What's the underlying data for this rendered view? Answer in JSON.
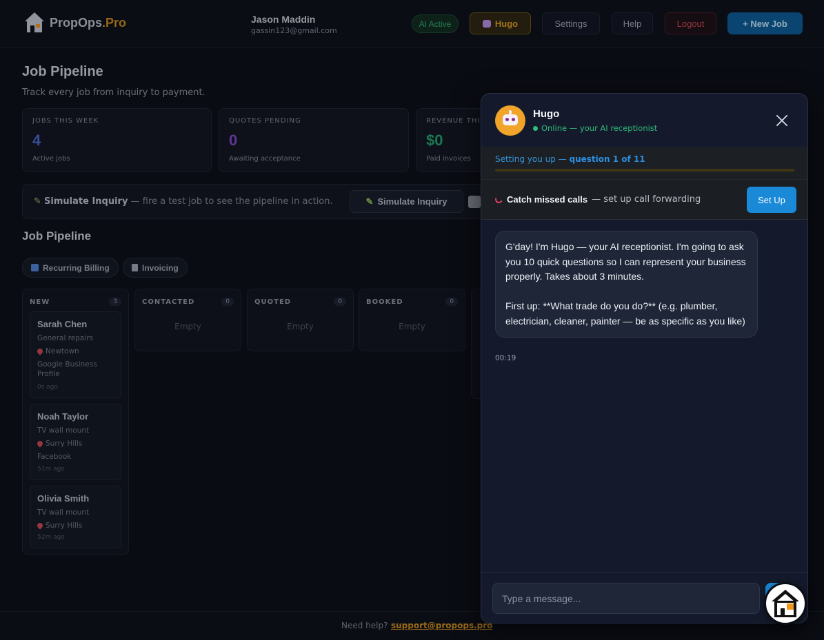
{
  "header": {
    "logo_main": "PropOps",
    "logo_accent": ".Pro",
    "user_name": "Jason Maddin",
    "user_email": "gassin123@gmail.com",
    "ai_status": "AI Active",
    "hugo_label": "Hugo",
    "settings_label": "Settings",
    "help_label": "Help",
    "logout_label": "Logout",
    "new_job_label": "+ New Job"
  },
  "page": {
    "title": "Job Pipeline",
    "subtitle": "Track every job from inquiry to payment."
  },
  "stats": [
    {
      "label": "JOBS THIS WEEK",
      "value": "4",
      "note": "Active jobs",
      "color": "#4a63c9"
    },
    {
      "label": "QUOTES PENDING",
      "value": "0",
      "note": "Awaiting acceptance",
      "color": "#7b46c4"
    },
    {
      "label": "REVENUE THIS",
      "value": "$0",
      "note": "Paid invoices",
      "color": "#1f9e6a"
    }
  ],
  "simulate": {
    "title": "Simulate Inquiry",
    "description": " — fire a test job to see the pipeline in action.",
    "button_label": "Simulate Inquiry"
  },
  "pipeline": {
    "title": "Job Pipeline",
    "tags": [
      "Recurring Billing",
      "Invoicing"
    ],
    "columns": [
      {
        "name": "NEW",
        "count": "3",
        "cards": [
          {
            "name": "Sarah Chen",
            "service": "General repairs",
            "location": "Newtown",
            "source": "Google Business Profile",
            "time": "0s ago"
          },
          {
            "name": "Noah Taylor",
            "service": "TV wall mount",
            "location": "Surry Hills",
            "source": "Facebook",
            "time": "51m ago"
          },
          {
            "name": "Olivia Smith",
            "service": "TV wall mount",
            "location": "Surry Hills",
            "source": "",
            "time": "52m ago"
          }
        ]
      },
      {
        "name": "CONTACTED",
        "count": "0",
        "empty": "Empty"
      },
      {
        "name": "QUOTED",
        "count": "0",
        "empty": "Empty"
      },
      {
        "name": "BOOKED",
        "count": "0",
        "empty": "Empty"
      }
    ]
  },
  "chat": {
    "bot_name": "Hugo",
    "status": "Online — your AI receptionist",
    "setup_prefix": "Setting you up — ",
    "setup_step": "question 1 of 11",
    "progress_fraction": 0.0,
    "missed_title": "Catch missed calls",
    "missed_desc": " — set up call forwarding",
    "setup_button": "Set Up",
    "message": "G'day! I'm Hugo — your AI receptionist. I'm going to ask you 10 quick questions so I can represent your business properly. Takes about 3 minutes.\n\nFirst up: **What trade do you do?** (e.g. plumber, electrician, cleaner, painter — be as specific as you like)",
    "message_time": "00:19",
    "input_placeholder": "Type a message..."
  },
  "footer": {
    "help_text": "Need help?",
    "support_email": "support@propops.pro"
  }
}
